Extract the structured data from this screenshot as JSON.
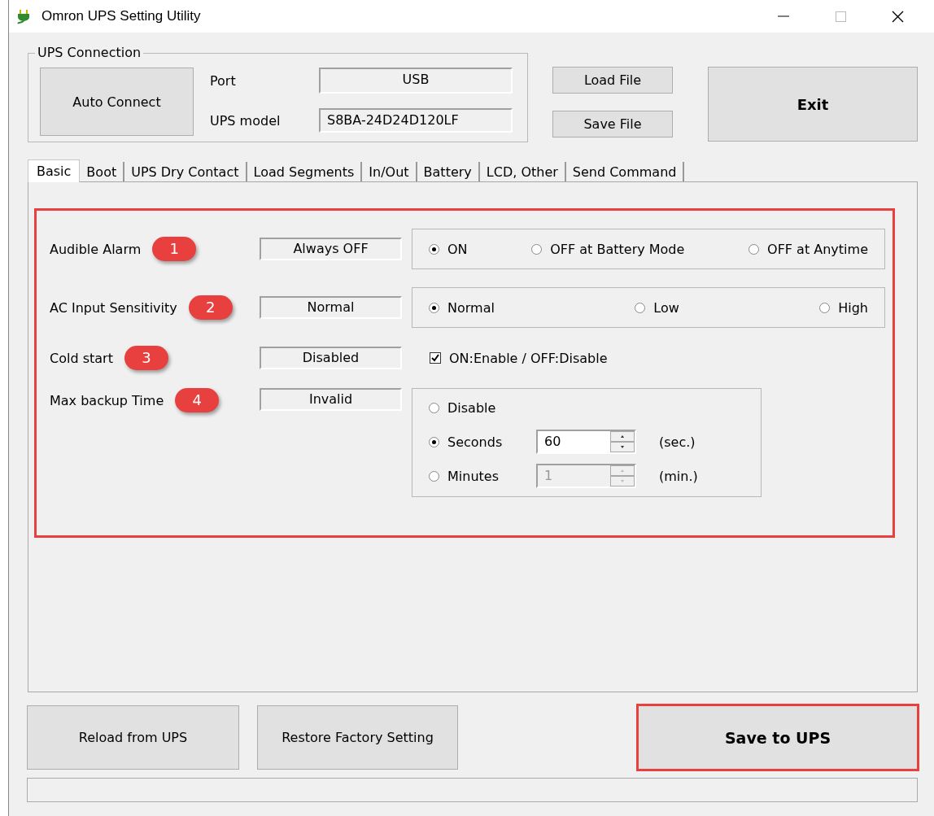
{
  "window": {
    "title": "Omron UPS Setting Utility"
  },
  "connection": {
    "title": "UPS Connection",
    "auto_connect": "Auto Connect",
    "fields": [
      {
        "label": "Port",
        "value": "USB"
      },
      {
        "label": "UPS model",
        "value": "S8BA-24D24D120LF"
      }
    ]
  },
  "file_buttons": [
    "Load File",
    "Save File"
  ],
  "exit_button": "Exit",
  "tabs": [
    {
      "label": "Basic",
      "selected": true
    },
    {
      "label": "Boot",
      "selected": false
    },
    {
      "label": "UPS Dry Contact",
      "selected": false
    },
    {
      "label": "Load Segments",
      "selected": false
    },
    {
      "label": "In/Out",
      "selected": false
    },
    {
      "label": "Battery",
      "selected": false
    },
    {
      "label": "LCD, Other",
      "selected": false
    },
    {
      "label": "Send Command",
      "selected": false
    }
  ],
  "settings_highlighted": true,
  "settings": [
    {
      "kind": "radio",
      "label": "Audible Alarm",
      "badge": "1",
      "current": "Always OFF",
      "options": [
        {
          "label": "ON",
          "selected": true
        },
        {
          "label": "OFF at Battery Mode",
          "selected": false
        },
        {
          "label": "OFF at Anytime",
          "selected": false
        }
      ]
    },
    {
      "kind": "radio",
      "label": "AC Input Sensitivity",
      "badge": "2",
      "current": "Normal",
      "options": [
        {
          "label": "Normal",
          "selected": true
        },
        {
          "label": "Low",
          "selected": false
        },
        {
          "label": "High",
          "selected": false
        }
      ]
    },
    {
      "kind": "checkbox",
      "label": "Cold start",
      "badge": "3",
      "current": "Disabled",
      "option": {
        "label": "ON:Enable / OFF:Disable",
        "checked": true
      }
    },
    {
      "kind": "timer",
      "label": "Max backup Time",
      "badge": "4",
      "current": "Invalid",
      "options": [
        {
          "label": "Disable",
          "selected": false
        },
        {
          "label": "Seconds",
          "selected": true,
          "value": "60",
          "unit": "(sec.)",
          "disabled": false
        },
        {
          "label": "Minutes",
          "selected": false,
          "value": "1",
          "unit": "(min.)",
          "disabled": true
        }
      ]
    }
  ],
  "bottom_buttons": [
    {
      "label": "Reload from UPS",
      "highlighted": false
    },
    {
      "label": "Restore Factory Setting",
      "highlighted": false
    },
    {
      "label": "Save to UPS",
      "highlighted": true
    }
  ]
}
